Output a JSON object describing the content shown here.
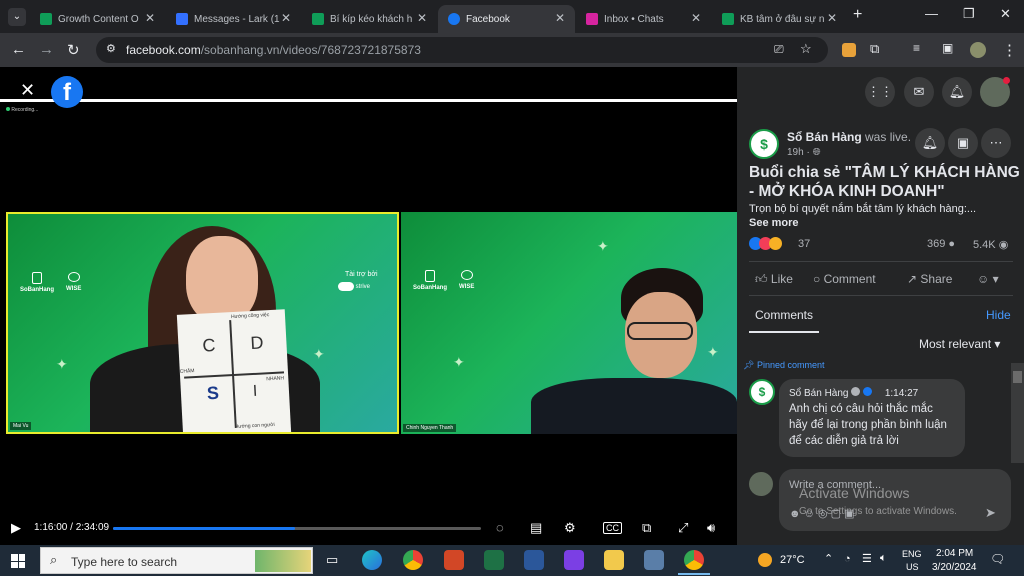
{
  "browser": {
    "tabs": [
      {
        "title": "Growth Content O",
        "fav_color": "#0f9d58"
      },
      {
        "title": "Messages - Lark (1",
        "fav_color": "#3370ff"
      },
      {
        "title": "Bí kíp kéo khách h",
        "fav_color": "#0f9d58"
      },
      {
        "title": "Facebook",
        "fav_color": "#1877f2"
      },
      {
        "title": "Inbox • Chats",
        "fav_color": "#d6249f"
      },
      {
        "title": "KB tâm ở đâu sự n",
        "fav_color": "#0f9d58"
      }
    ],
    "new_tab": "+",
    "url_domain": "facebook.com",
    "url_path": "/sobanhang.vn/videos/768723721875873"
  },
  "video": {
    "recording_label": "Recording...",
    "participant1": {
      "name": "Mai Vu",
      "brand1": "SoBanHang",
      "brand2": "WISE",
      "sponsor_label": "Tài trợ bởi",
      "sponsor_name": "strive",
      "paper_top": "Hướng công việc",
      "paper_left": "CHẬM",
      "paper_right": "NHANH",
      "paper_bottom": "Hướng con người",
      "quadrants": [
        "C",
        "D",
        "S",
        "I"
      ]
    },
    "participant2": {
      "name": "Chinh Nguyen Thanh",
      "brand1": "SoBanHang",
      "brand2": "WISE"
    },
    "time_current": "1:16:00",
    "time_total": "2:34:09",
    "progress": 0.495
  },
  "post": {
    "page_name": "Sổ Bán Hàng",
    "status": "was live.",
    "time": "19h",
    "title": "Buổi chia sẻ \"TÂM LÝ KHÁCH HÀNG - MỞ KHÓA KINH DOANH\"",
    "description": "Trọn bộ bí quyết nắm bắt tâm lý khách hàng:...",
    "see_more": "See more",
    "reactions_count": "37",
    "comments_count": "369",
    "views_count": "5.4K",
    "like_label": "Like",
    "comment_label": "Comment",
    "share_label": "Share",
    "comments_tab": "Comments",
    "hide_label": "Hide",
    "sort_label": "Most relevant",
    "pinned_label": "Pinned comment",
    "pinned_author": "Sổ Bán Hàng",
    "pinned_time": "1:14:27",
    "pinned_text": "Anh chị có câu hỏi thắc mắc hãy để lại trong phần bình luận để các diễn giả trả lời",
    "write_placeholder": "Write a comment...",
    "activate_title": "Activate Windows",
    "activate_sub": "Go to Settings to activate Windows."
  },
  "taskbar": {
    "search_placeholder": "Type here to search",
    "weather": "27°C",
    "lang1": "ENG",
    "lang2": "US",
    "time": "2:04 PM",
    "date": "3/20/2024"
  }
}
